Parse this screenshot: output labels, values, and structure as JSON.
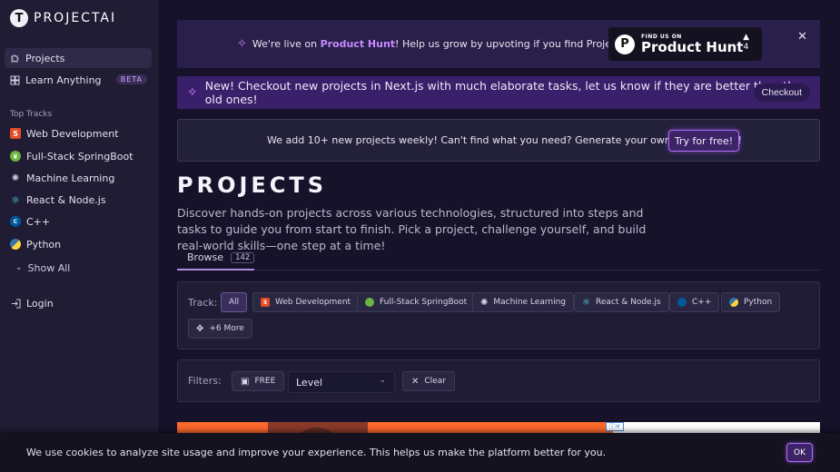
{
  "app": {
    "name": "PROJECTAI",
    "logo_letter": "T"
  },
  "sidebar": {
    "items": [
      {
        "label": "Projects",
        "icon": "puzzle-icon"
      },
      {
        "label": "Learn Anything",
        "icon": "grid-icon",
        "badge": "BETA"
      }
    ],
    "section_title": "Top Tracks",
    "tracks": [
      {
        "label": "Web Development",
        "icon": "html5-icon",
        "color": "#e44d26"
      },
      {
        "label": "Full-Stack SpringBoot",
        "icon": "spring-icon",
        "color": "#6db33f"
      },
      {
        "label": "Machine Learning",
        "icon": "brain-icon",
        "color": "#cfc9e2"
      },
      {
        "label": "React & Node.js",
        "icon": "react-icon",
        "color": "#61dafb"
      },
      {
        "label": "C++",
        "icon": "cpp-icon",
        "color": "#00599c"
      },
      {
        "label": "Python",
        "icon": "python-icon",
        "color": "#ffd43b"
      }
    ],
    "show_all": "Show All",
    "login": "Login"
  },
  "ph_banner": {
    "prefix": "We're live on",
    "highlight": "Product Hunt",
    "suffix": "! Help us grow by upvoting if you find ProjectAI helpful.",
    "card_small": "FIND US ON",
    "card_big": "Product Hunt",
    "votes": "4"
  },
  "news": {
    "text": "New! Checkout new projects in Next.js with much elaborate tasks, let us know if they are better than the old ones!",
    "button": "Checkout"
  },
  "generate": {
    "text": "We add 10+ new projects weekly! Can't find what you need? Generate your own projects now!",
    "button": "Try for free!"
  },
  "page": {
    "title": "PROJECTS",
    "description": "Discover hands-on projects across various technologies, structured into steps and tasks to guide you from start to finish. Pick a project, challenge yourself, and build real-world skills—one step at a time!"
  },
  "tabs": [
    {
      "label": "Browse",
      "count": "142"
    }
  ],
  "track_filter": {
    "label": "Track:",
    "chips": [
      "All",
      "Web Development",
      "Full-Stack SpringBoot",
      "Machine Learning",
      "React & Node.js",
      "C++",
      "Python"
    ],
    "more": "+6 More"
  },
  "filters": {
    "label": "Filters:",
    "free": "FREE",
    "level": "Level",
    "clear": "Clear"
  },
  "cookie": {
    "text": "We use cookies to analyze site usage and improve your experience. This helps us make the platform better for you.",
    "ok": "OK"
  },
  "colors": {
    "accent": "#b26bff",
    "highlight": "#c58cff",
    "banner": "#3a1f6a"
  }
}
